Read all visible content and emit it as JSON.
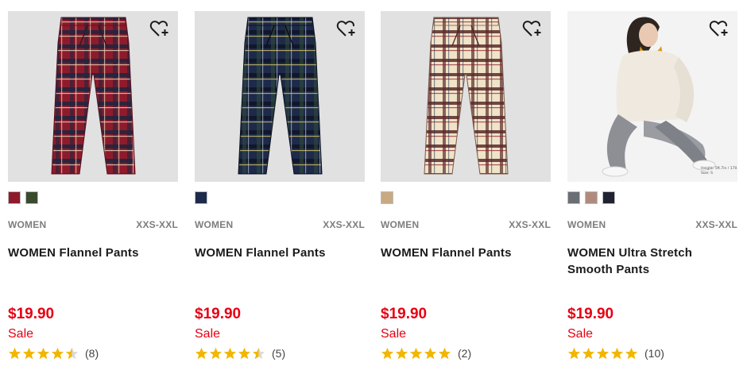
{
  "colors": {
    "price": "#e60012",
    "sale": "#e60012",
    "star": "#f2b600",
    "meta": "#7d7d7d"
  },
  "products": [
    {
      "gender": "WOMEN",
      "size_range": "XXS-XXL",
      "name": "WOMEN Flannel Pants",
      "price": "$19.90",
      "flag": "Sale",
      "rating": 4.5,
      "review_count": "(8)",
      "swatches": [
        "#8e1b2b",
        "#3b4a2f"
      ],
      "image": "red-plaid-pants"
    },
    {
      "gender": "WOMEN",
      "size_range": "XXS-XXL",
      "name": "WOMEN Flannel Pants",
      "price": "$19.90",
      "flag": "Sale",
      "rating": 4.5,
      "review_count": "(5)",
      "swatches": [
        "#1d2a4a"
      ],
      "image": "navy-plaid-pants"
    },
    {
      "gender": "WOMEN",
      "size_range": "XXS-XXL",
      "name": "WOMEN Flannel Pants",
      "price": "$19.90",
      "flag": "Sale",
      "rating": 5,
      "review_count": "(2)",
      "swatches": [
        "#c8a982"
      ],
      "image": "beige-plaid-pants"
    },
    {
      "gender": "WOMEN",
      "size_range": "XXS-XXL",
      "name": "WOMEN Ultra Stretch Smooth Pants",
      "price": "$19.90",
      "flag": "Sale",
      "rating": 5,
      "review_count": "(10)",
      "swatches": [
        "#6b6e73",
        "#b08b7d",
        "#1f2230"
      ],
      "image": "model-seated-gray-pants",
      "photo_caption": "Height: 5ft.7in / 170.8cm\nSize: S"
    }
  ]
}
